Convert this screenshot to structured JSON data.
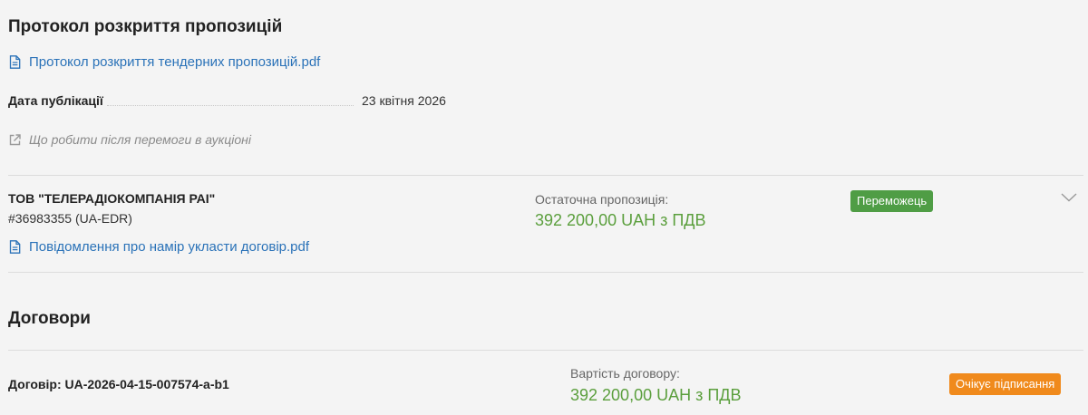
{
  "protocol": {
    "title": "Протокол розкриття пропозицій",
    "file_link": "Протокол розкриття тендерних пропозицій.pdf",
    "pub_date_label": "Дата публікації",
    "pub_date_value": "23 квітня 2026",
    "after_win_link": "Що робити після перемоги в аукціоні"
  },
  "bidder": {
    "name": "ТОВ \"ТЕЛЕРАДІОКОМПАНІЯ РАІ\"",
    "code": "#36983355 (UA-EDR)",
    "final_offer_label": "Остаточна пропозиція:",
    "final_offer_amount": "392 200,00 UAH з ПДВ",
    "status_badge": "Переможець",
    "notice_link": "Повідомлення про намір укласти договір.pdf"
  },
  "contracts": {
    "title": "Договори",
    "contract_label": "Договір: UA-2026-04-15-007574-a-b1",
    "value_label": "Вартість договору:",
    "value_amount": "392 200,00 UAH з ПДВ",
    "status_badge": "Очікує підписання"
  },
  "colors": {
    "link": "#2a72b8",
    "amount": "#5b9f3d",
    "winner_badge": "#4f9d45",
    "pending_badge": "#f08a1c"
  },
  "icons": {
    "document": "document-icon",
    "external": "external-link-icon",
    "chevron": "chevron-down-icon"
  }
}
